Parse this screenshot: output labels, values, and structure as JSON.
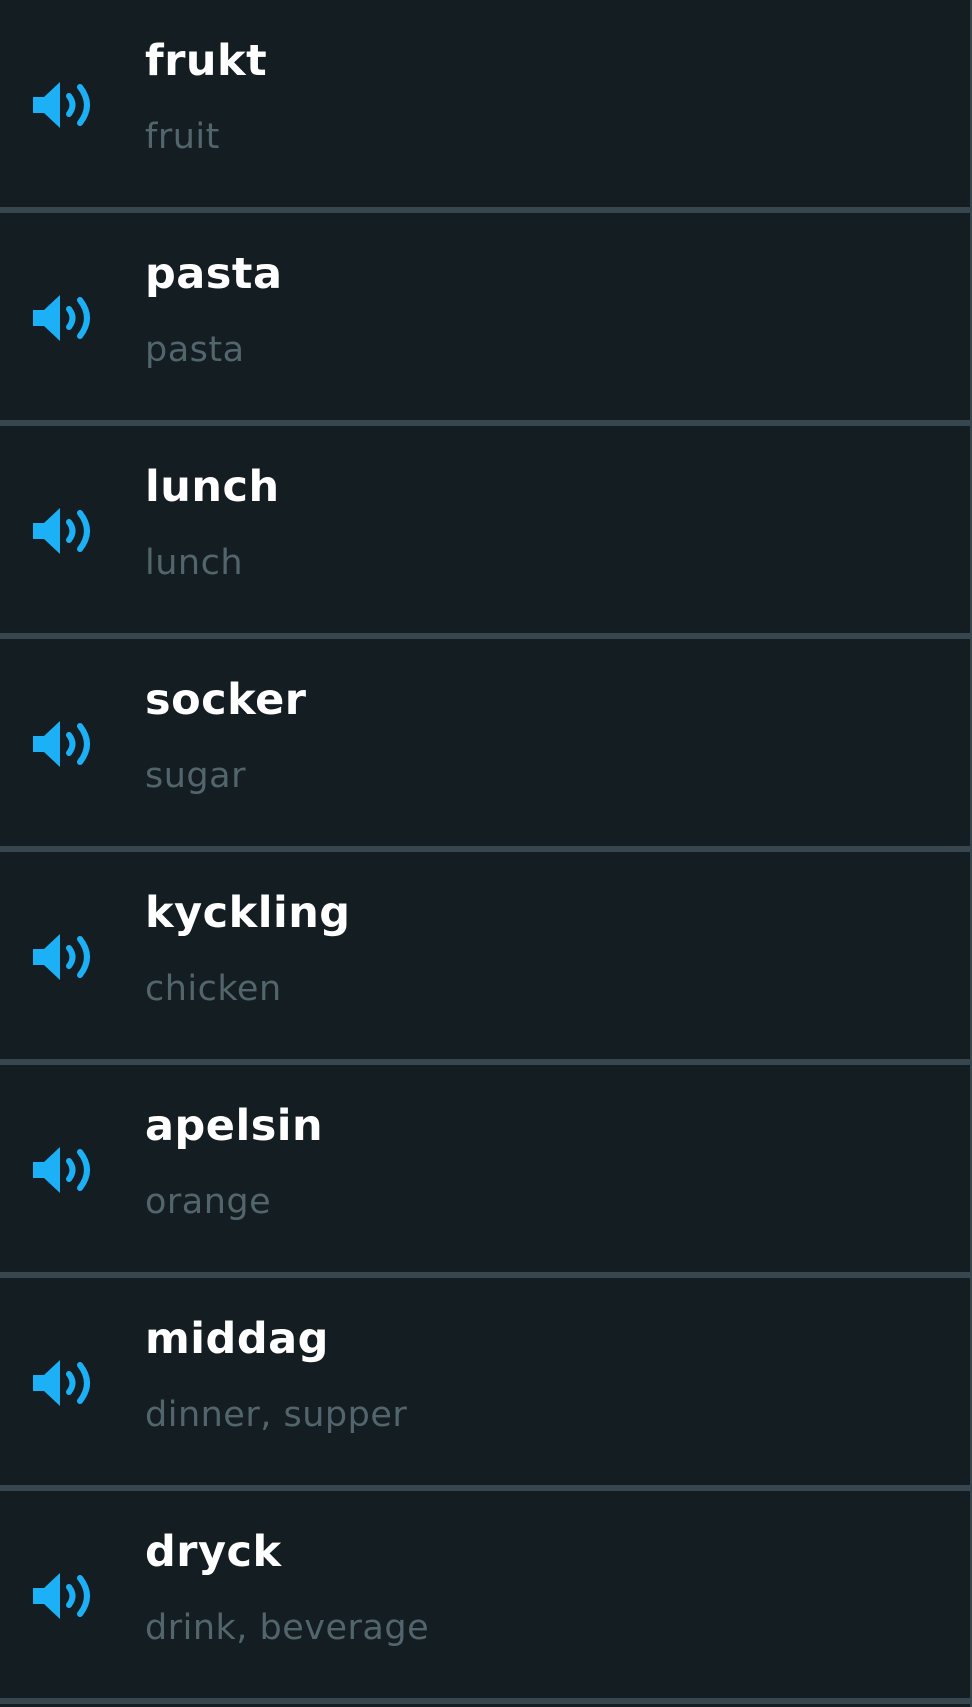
{
  "colors": {
    "background": "#141d22",
    "divider": "#37464f",
    "accent": "#1cb0f6",
    "word": "#ffffff",
    "translation": "#52656d"
  },
  "icon": "speaker-icon",
  "items": [
    {
      "word": "frukt",
      "translation": "fruit"
    },
    {
      "word": "pasta",
      "translation": "pasta"
    },
    {
      "word": "lunch",
      "translation": "lunch"
    },
    {
      "word": "socker",
      "translation": "sugar"
    },
    {
      "word": "kyckling",
      "translation": "chicken"
    },
    {
      "word": "apelsin",
      "translation": "orange"
    },
    {
      "word": "middag",
      "translation": "dinner, supper"
    },
    {
      "word": "dryck",
      "translation": "drink, beverage"
    }
  ]
}
